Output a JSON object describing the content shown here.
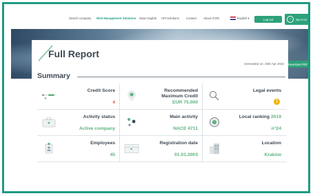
{
  "nav": {
    "items": [
      "Search company",
      "Risk Management Solutions",
      "Data Insights",
      "API Solutions",
      "Contact",
      "About ICON"
    ],
    "language": "English",
    "login": "Log out",
    "account": "My Acco"
  },
  "hero": {
    "download": "Download PDF"
  },
  "report": {
    "title": "Full Report",
    "generated": "Generated on: 25th Apr 2022",
    "summary": "Summary"
  },
  "cells": {
    "credit_score": {
      "label": "Credit Score",
      "value": "4"
    },
    "max_credit": {
      "label1": "Recommended",
      "label2": "Maximum Credit",
      "value": "EUR 75.000"
    },
    "legal": {
      "label": "Legal events",
      "value": "!"
    },
    "activity_status": {
      "label": "Activity status",
      "value": "Active company"
    },
    "main_activity": {
      "label": "Main activity",
      "value": "NACE 4711"
    },
    "local_ranking": {
      "label": "Local ranking",
      "year": "2019",
      "value": "n°24"
    },
    "employees": {
      "label": "Employees",
      "value": "45"
    },
    "registration": {
      "label": "Registration date",
      "value": "01.01.2003"
    },
    "location": {
      "label": "Location",
      "value": "Kraków"
    }
  },
  "colors": {
    "accent": "#2da27a",
    "frame": "#1f9a84",
    "value_green": "#5bb27d",
    "value_red": "#e2574c",
    "warning": "#f0b400"
  }
}
